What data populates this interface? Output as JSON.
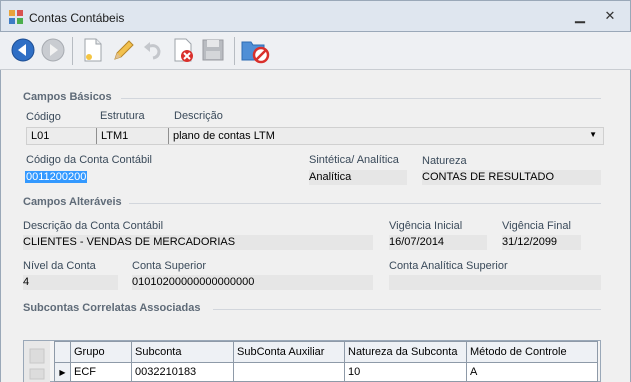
{
  "window": {
    "title": "Contas Contábeis",
    "minimize_label": "▁",
    "close_label": "✕"
  },
  "toolbar": {
    "buttons": [
      {
        "name": "back-icon",
        "enabled": true
      },
      {
        "name": "forward-icon",
        "enabled": false
      },
      {
        "name": "new-document-icon",
        "enabled": true
      },
      {
        "name": "edit-pencil-icon",
        "enabled": true
      },
      {
        "name": "undo-icon",
        "enabled": false
      },
      {
        "name": "delete-icon",
        "enabled": true
      },
      {
        "name": "save-icon",
        "enabled": false
      },
      {
        "name": "close-folder-icon",
        "enabled": true
      }
    ]
  },
  "basic": {
    "section_title": "Campos Básicos",
    "codigo_label": "Código",
    "estrutura_label": "Estrutura",
    "descricao_label": "Descrição",
    "codigo_value": "L01",
    "estrutura_value": "LTM1",
    "descricao_value": "plano de contas LTM",
    "codigo_conta_label": "Código da Conta Contábil",
    "codigo_conta_value": "0011200200",
    "sintetica_label": "Sintética/ Analítica",
    "sintetica_value": "Analítica",
    "natureza_label": "Natureza",
    "natureza_value": "CONTAS DE RESULTADO"
  },
  "alteraveis": {
    "section_title": "Campos Alteráveis",
    "descricao_conta_label": "Descrição da Conta Contábil",
    "descricao_conta_value": "CLIENTES - VENDAS DE MERCADORIAS",
    "vig_inicial_label": "Vigência Inicial",
    "vig_inicial_value": "16/07/2014",
    "vig_final_label": "Vigência Final",
    "vig_final_value": "31/12/2099",
    "nivel_label": "Nível da Conta",
    "nivel_value": "4",
    "superior_label": "Conta Superior",
    "superior_value": "01010200000000000000",
    "analitica_sup_label": "Conta Analítica Superior",
    "analitica_sup_value": ""
  },
  "subcontas": {
    "section_title": "Subcontas Correlatas Associadas",
    "columns": [
      "Grupo",
      "Subconta",
      "SubConta Auxiliar",
      "Natureza da Subconta",
      "Método de Controle"
    ],
    "rows": [
      [
        "ECF",
        "0032210183",
        "",
        "10",
        "A"
      ]
    ]
  },
  "colors": {
    "selection": "#3399ff",
    "section_text": "#5f6b78"
  }
}
